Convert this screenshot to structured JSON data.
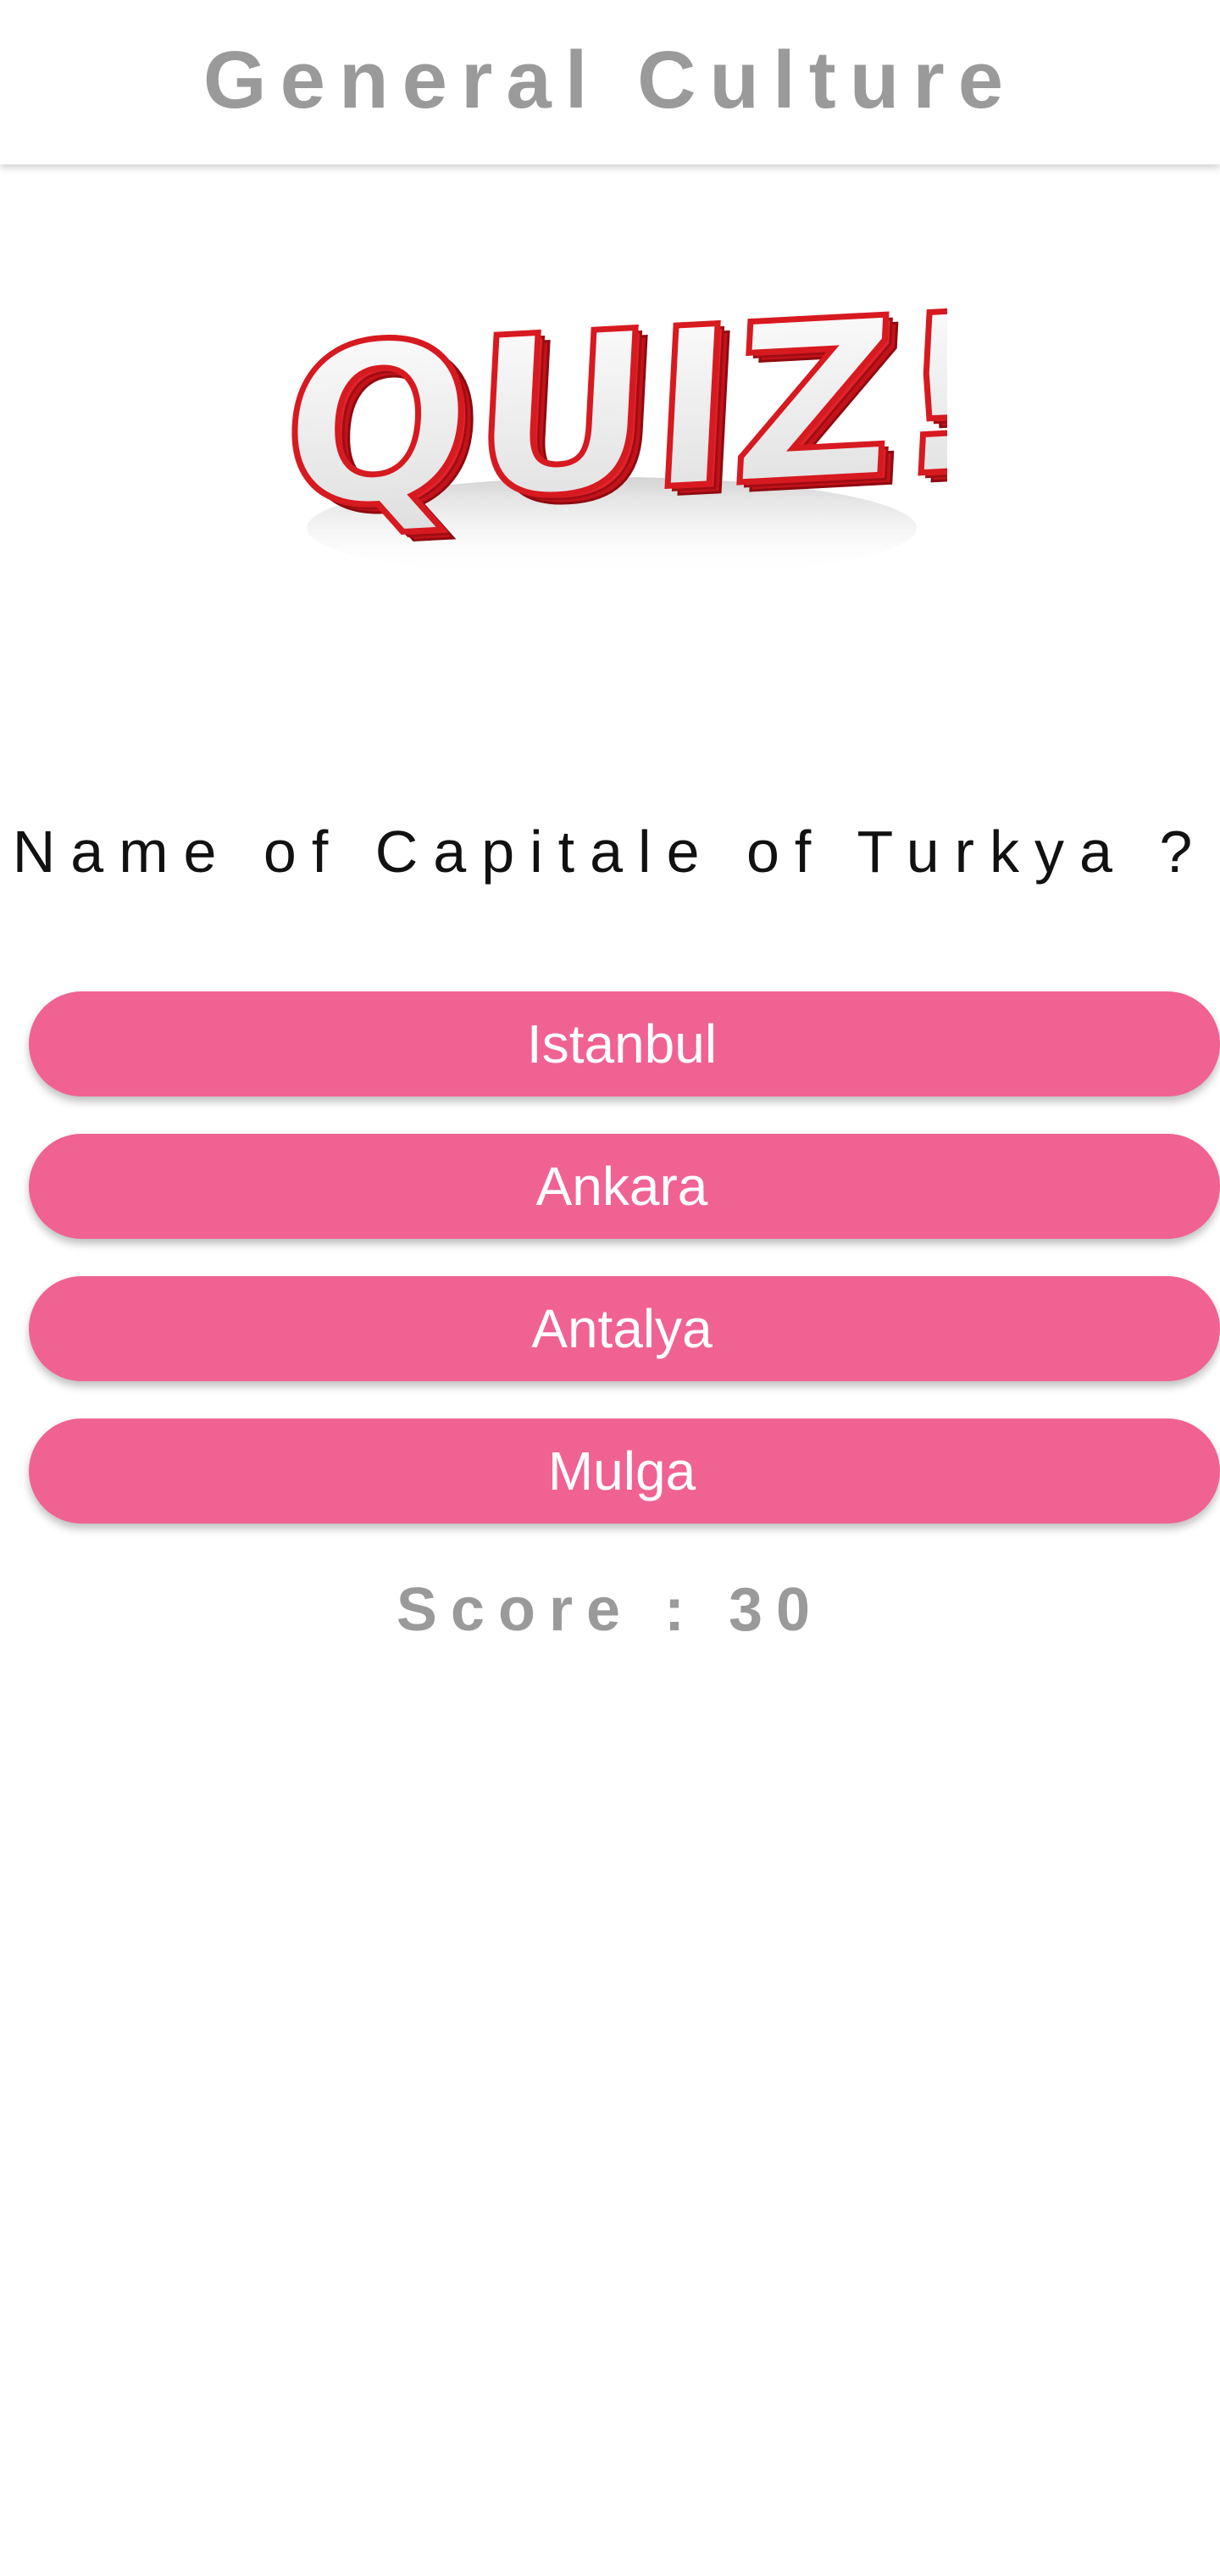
{
  "app_bar": {
    "title": "General Culture"
  },
  "logo": {
    "text": "QUIZ!",
    "colors": {
      "face": "#f2f2f2",
      "side": "#d71920",
      "outline": "#b30d14"
    }
  },
  "question": {
    "text": "Name of Capitale of Turkya ?"
  },
  "answers": [
    {
      "label": "Istanbul"
    },
    {
      "label": "Ankara"
    },
    {
      "label": "Antalya"
    },
    {
      "label": "Mulga"
    }
  ],
  "score": {
    "text": "Score : 30"
  },
  "colors": {
    "accent": "#f06292",
    "title_gray": "#9a9a9a",
    "question_text": "#111111"
  }
}
